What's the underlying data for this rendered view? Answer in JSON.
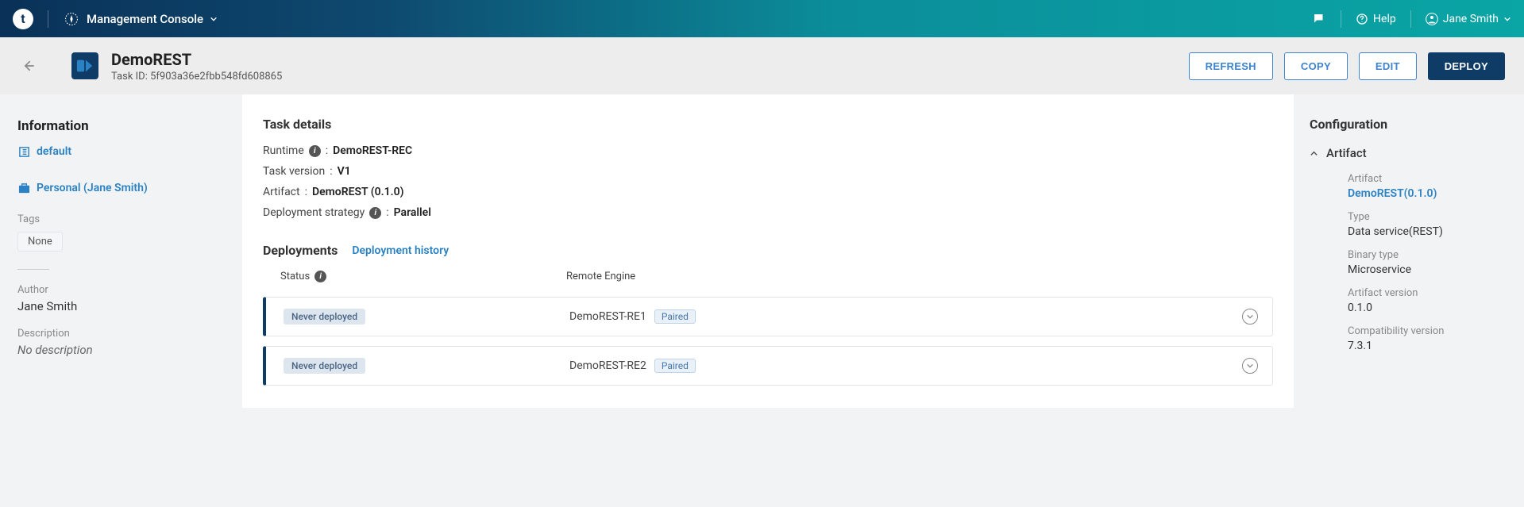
{
  "topbar": {
    "app_initial": "t",
    "app_name": "Management Console",
    "help_label": "Help",
    "user_name": "Jane Smith"
  },
  "toolbar": {
    "title": "DemoREST",
    "task_id_label": "Task ID:",
    "task_id": "5f903a36e2fbb548fd608865",
    "refresh": "REFRESH",
    "copy": "COPY",
    "edit": "EDIT",
    "deploy": "DEPLOY"
  },
  "left": {
    "heading": "Information",
    "nav_default": "default",
    "nav_personal": "Personal (Jane Smith)",
    "tags_label": "Tags",
    "tag_none": "None",
    "author_label": "Author",
    "author_value": "Jane Smith",
    "desc_label": "Description",
    "desc_value": "No description"
  },
  "center": {
    "details_heading": "Task details",
    "runtime_label": "Runtime",
    "runtime_value": "DemoREST-REC",
    "version_label": "Task version",
    "version_value": "V1",
    "artifact_label": "Artifact",
    "artifact_value": "DemoREST (0.1.0)",
    "strategy_label": "Deployment strategy",
    "strategy_value": "Parallel",
    "deploys_heading": "Deployments",
    "history_link": "Deployment history",
    "col_status": "Status",
    "col_engine": "Remote Engine",
    "rows": [
      {
        "status": "Never deployed",
        "engine": "DemoREST-RE1",
        "paired": "Paired"
      },
      {
        "status": "Never deployed",
        "engine": "DemoREST-RE2",
        "paired": "Paired"
      }
    ]
  },
  "right": {
    "heading": "Configuration",
    "section": "Artifact",
    "artifact_lbl": "Artifact",
    "artifact_val": "DemoREST(0.1.0)",
    "type_lbl": "Type",
    "type_val": "Data service(REST)",
    "binary_lbl": "Binary type",
    "binary_val": "Microservice",
    "ver_lbl": "Artifact version",
    "ver_val": "0.1.0",
    "compat_lbl": "Compatibility version",
    "compat_val": "7.3.1"
  }
}
